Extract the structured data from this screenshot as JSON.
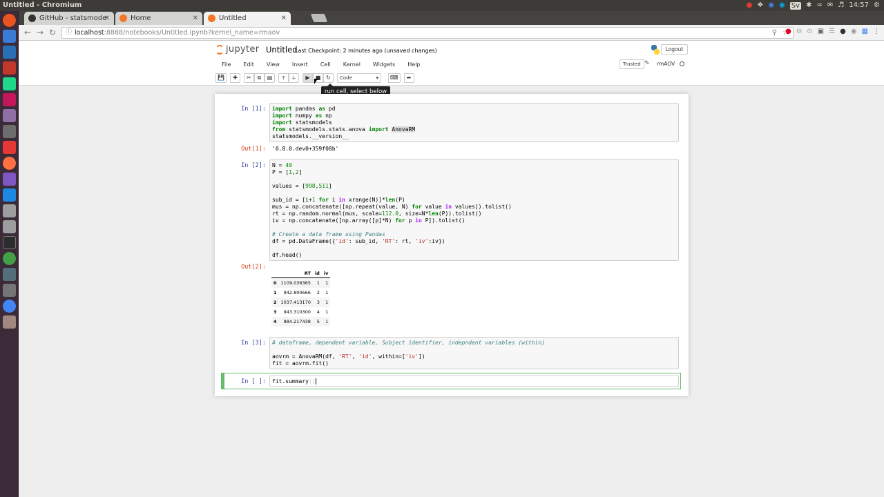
{
  "os": {
    "window_title": "Untitled - Chromium",
    "clock": "14:57",
    "lang": "Sv"
  },
  "browser": {
    "tabs": [
      {
        "label": "GitHub - statsmode",
        "favicon_color": "#333333"
      },
      {
        "label": "Home",
        "favicon_color": "#f37726"
      },
      {
        "label": "Untitled",
        "favicon_color": "#f37726"
      }
    ],
    "url_host": "localhost",
    "url_rest": ":8888/notebooks/Untitled.ipynb?kernel_name=rmaov"
  },
  "jupyter": {
    "logo_text": "jupyter",
    "notebook_name": "Untitled",
    "checkpoint": "Last Checkpoint: 2 minutes ago (unsaved changes)",
    "logout": "Logout",
    "menu": [
      "File",
      "Edit",
      "View",
      "Insert",
      "Cell",
      "Kernel",
      "Widgets",
      "Help"
    ],
    "trusted": "Trusted",
    "kernel_name": "rmAOV",
    "cell_type": "Code",
    "tooltip": "run cell, select below"
  },
  "cells": {
    "c1": {
      "prompt": "In [1]:",
      "out_prompt": "Out[1]:",
      "output": "'0.8.0.dev0+359f08b'"
    },
    "c2": {
      "prompt": "In [2]:",
      "out_prompt": "Out[2]:"
    },
    "c3": {
      "prompt": "In [3]:"
    },
    "c4": {
      "prompt": "In [ ]:"
    }
  },
  "dataframe": {
    "columns": [
      "",
      "RT",
      "id",
      "iv"
    ],
    "rows": [
      [
        "0",
        "1109.036365",
        "1",
        "1"
      ],
      [
        "1",
        "942.800666",
        "2",
        "1"
      ],
      [
        "2",
        "1037.413170",
        "3",
        "1"
      ],
      [
        "3",
        "943.310300",
        "4",
        "1"
      ],
      [
        "4",
        "884.217438",
        "5",
        "1"
      ]
    ]
  }
}
